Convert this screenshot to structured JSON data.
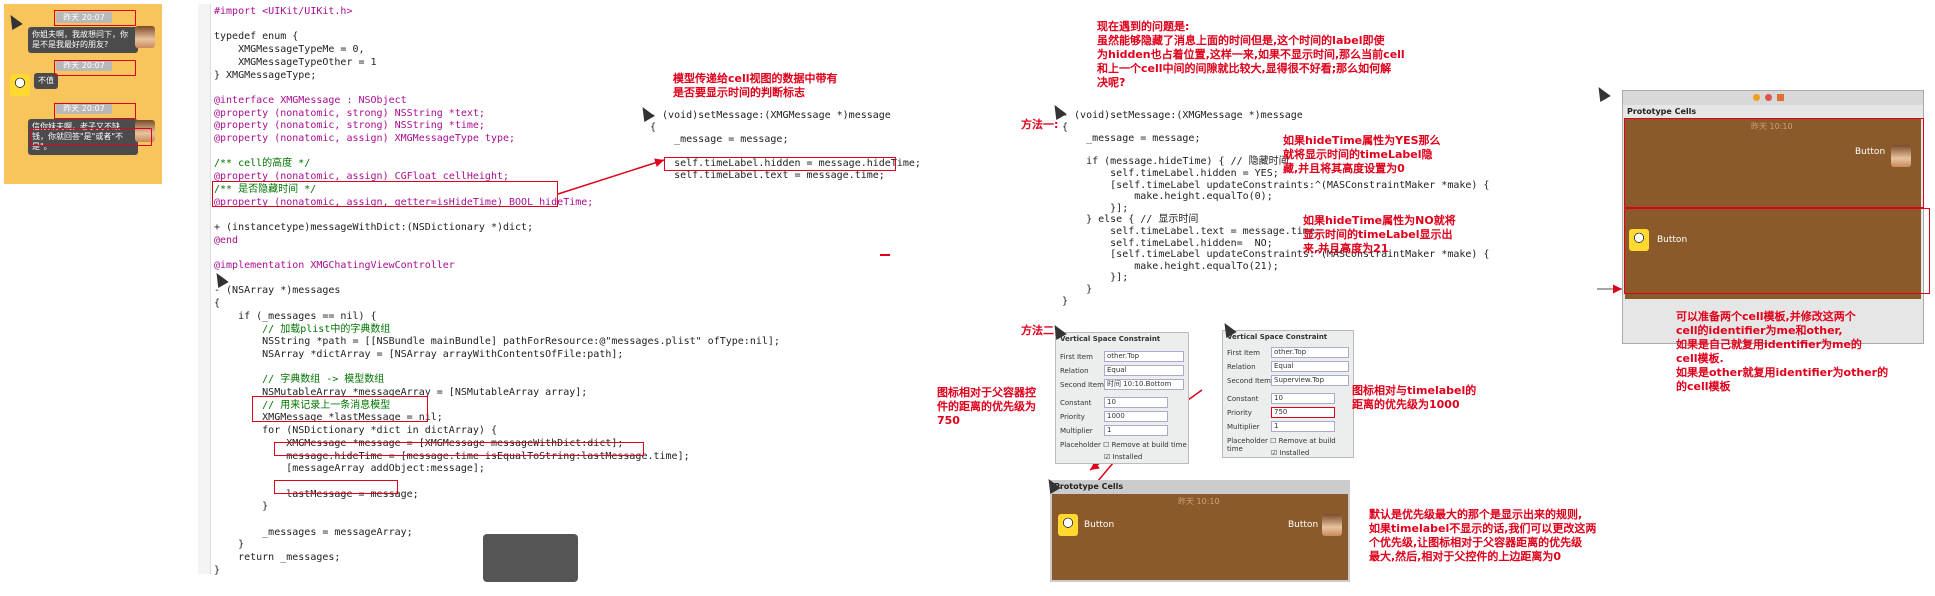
{
  "chat": {
    "time1": "昨天 20:07",
    "msg1": "你姐夫啊，我故想问下，你是不是我最好的朋友?",
    "msg2": "不值",
    "time2": "昨天 20:07",
    "time3": "昨天 20:07",
    "msg3": "信你妹夫啊，老子又不缺钱，你就回答\"是\"或者\"不是\"。"
  },
  "code_main": {
    "lines": [
      "#import <UIKit/UIKit.h>",
      "",
      "typedef enum {",
      "    XMGMessageTypeMe = 0,",
      "    XMGMessageTypeOther = 1",
      "} XMGMessageType;",
      "",
      "@interface XMGMessage : NSObject",
      "@property (nonatomic, strong) NSString *text;",
      "@property (nonatomic, strong) NSString *time;",
      "@property (nonatomic, assign) XMGMessageType type;",
      "",
      "/** cell的高度 */",
      "@property (nonatomic, assign) CGFloat cellHeight;",
      "/** 是否隐藏时间 */",
      "@property (nonatomic, assign, getter=isHideTime) BOOL hideTime;",
      "",
      "+ (instancetype)messageWithDict:(NSDictionary *)dict;",
      "@end",
      "",
      "@implementation XMGChatingViewController",
      "",
      "- (NSArray *)messages",
      "{",
      "    if (_messages == nil) {",
      "        // 加载plist中的字典数组",
      "        NSString *path = [[NSBundle mainBundle] pathForResource:@\"messages.plist\" ofType:nil];",
      "        NSArray *dictArray = [NSArray arrayWithContentsOfFile:path];",
      "",
      "        // 字典数组 -> 模型数组",
      "        NSMutableArray *messageArray = [NSMutableArray array];",
      "        // 用来记录上一条消息模型",
      "        XMGMessage *lastMessage = nil;",
      "        for (NSDictionary *dict in dictArray) {",
      "            XMGMessage *message = [XMGMessage messageWithDict:dict];",
      "            message.hideTime = [message.time isEqualToString:lastMessage.time];",
      "            [messageArray addObject:message];",
      "",
      "            lastMessage = message;",
      "        }",
      "",
      "        _messages = messageArray;",
      "    }",
      "    return _messages;",
      "}"
    ]
  },
  "note_model": "模型传递给cell视图的数据中带有\n是否要显示时间的判断标志",
  "code_setter": {
    "lines": [
      "- (void)setMessage:(XMGMessage *)message",
      "{",
      "    _message = message;",
      "",
      "    self.timeLabel.hidden = message.hideTime;",
      "    self.timeLabel.text = message.time;"
    ]
  },
  "problem_note": "现在遇到的问题是:\n虽然能够隐藏了消息上面的时间但是,这个时间的label即使\n为hidden也占着位置,这样一来,如果不显示时间,那么当前cell\n和上一个cell中间的间隙就比较大,显得很不好看;那么如何解\n决呢?",
  "method1_label": "方法一:",
  "method2_label": "方法二:",
  "code_method1": {
    "lines": [
      "- (void)setMessage:(XMGMessage *)message",
      "{",
      "    _message = message;",
      "",
      "    if (message.hideTime) { // 隐藏时间",
      "        self.timeLabel.hidden = YES;",
      "        [self.timeLabel updateConstraints:^(MASConstraintMaker *make) {",
      "            make.height.equalTo(0);",
      "        }];",
      "    } else { // 显示时间",
      "        self.timeLabel.text = message.time;",
      "        self.timeLabel.hidden=  NO;",
      "        [self.timeLabel updateConstraints:^(MASConstraintMaker *make) {",
      "            make.height.equalTo(21);",
      "        }];",
      "    }",
      "}"
    ]
  },
  "note_yes": "如果hideTime属性为YES那么\n就将显示时间的timeLabel隐\n藏,并且将其高度设置为0",
  "note_no": "如果hideTime属性为NO就将\n显示时间的timeLabel显示出\n来,并且高度为21",
  "constraint_panel_1": {
    "title": "Vertical Space Constraint",
    "first_item": "other.Top",
    "relation": "Equal",
    "second_item": "时间 10:10.Bottom",
    "constant": "10",
    "priority": "1000",
    "multiplier": "1",
    "placeholder": "Remove at build time",
    "installed": "Installed"
  },
  "constraint_panel_2": {
    "title": "Vertical Space Constraint",
    "first_item": "other.Top",
    "relation": "Equal",
    "second_item": "Superview.Top",
    "constant": "10",
    "priority": "750",
    "multiplier": "1",
    "placeholder": "Remove at build time",
    "installed": "Installed"
  },
  "note_750": "图标相对于父容器控\n件的距离的优先级为\n750",
  "note_1000": "图标相对与timelabel的\n距离的优先级为1000",
  "prototype_cells": "Prototype Cells",
  "button_label": "Button",
  "cell_time": "昨天 10:10",
  "note_default": "默认是优先级最大的那个是显示出来的规则,\n如果timelabel不显示的话,我们可以更改这两\n个优先级,让图标相对于父容器距离的优先级\n最大,然后,相对于父控件的上边距离为0",
  "note_right": "可以准备两个cell模板,并修改这两个\ncell的identifier为me和other,\n如果是自己就复用identifier为me的\ncell模板.\n如果是other就复用identifier为other的\n的cell模板",
  "right_cell_time": "昨天 10:10"
}
